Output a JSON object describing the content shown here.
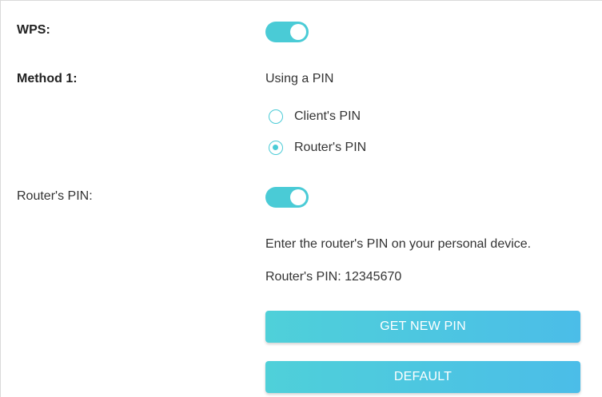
{
  "wps": {
    "label": "WPS:",
    "enabled": true
  },
  "method1": {
    "label": "Method 1:",
    "title": "Using a PIN",
    "options": [
      {
        "label": "Client's PIN",
        "checked": false
      },
      {
        "label": "Router's PIN",
        "checked": true
      }
    ]
  },
  "router_pin": {
    "label": "Router's PIN:",
    "enabled": true,
    "instruction": "Enter the router's PIN on your personal device.",
    "pin_text": "Router's PIN: 12345670",
    "get_new_pin_label": "GET NEW PIN",
    "default_label": "DEFAULT"
  },
  "colors": {
    "accent": "#4acbd6",
    "button_gradient_start": "#4fd0d9",
    "button_gradient_end": "#4bbde8"
  },
  "icons": {
    "toggle": "toggle-switch-icon",
    "radio": "radio-button-icon"
  }
}
